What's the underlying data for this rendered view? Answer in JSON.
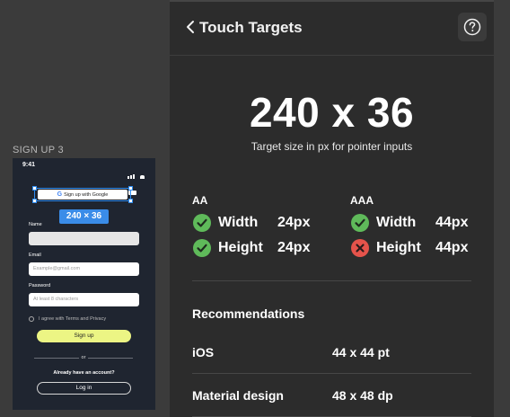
{
  "canvas": {
    "frame_label": "SIGN UP 3",
    "phone": {
      "time": "9:41",
      "google_button": "Sign up with Google",
      "google_glyph": "G",
      "dimension_badge": "240 × 36",
      "name_label": "Name",
      "email_label": "Email",
      "email_placeholder": "Example@gmail.com",
      "password_label": "Password",
      "password_placeholder": "At least 8 characters",
      "agree_text": "I agree with Terms and Privacy",
      "signup_button": "Sign up",
      "or_text": "or",
      "already_text": "Already have an account?",
      "login_button": "Log in"
    }
  },
  "panel": {
    "title": "Touch Targets",
    "size_value": "240 x 36",
    "size_caption": "Target size in px for pointer inputs",
    "levels": [
      {
        "name": "AA",
        "rows": [
          {
            "label": "Width",
            "value": "24px",
            "status": "pass"
          },
          {
            "label": "Height",
            "value": "24px",
            "status": "pass"
          }
        ]
      },
      {
        "name": "AAA",
        "rows": [
          {
            "label": "Width",
            "value": "44px",
            "status": "pass"
          },
          {
            "label": "Height",
            "value": "44px",
            "status": "fail"
          }
        ]
      }
    ],
    "recommendations": {
      "title": "Recommendations",
      "items": [
        {
          "name": "iOS",
          "value": "44 x 44 pt"
        },
        {
          "name": "Material design",
          "value": "48 x 48 dp"
        }
      ]
    }
  },
  "colors": {
    "pass": "#5fba5a",
    "fail": "#e5534b",
    "selection": "#2f8cf0",
    "accent_button": "#ecf584"
  },
  "icons": {
    "back": "chevron-left-icon",
    "help": "question-circle-icon",
    "pass": "check-circle-icon",
    "fail": "x-circle-icon"
  }
}
